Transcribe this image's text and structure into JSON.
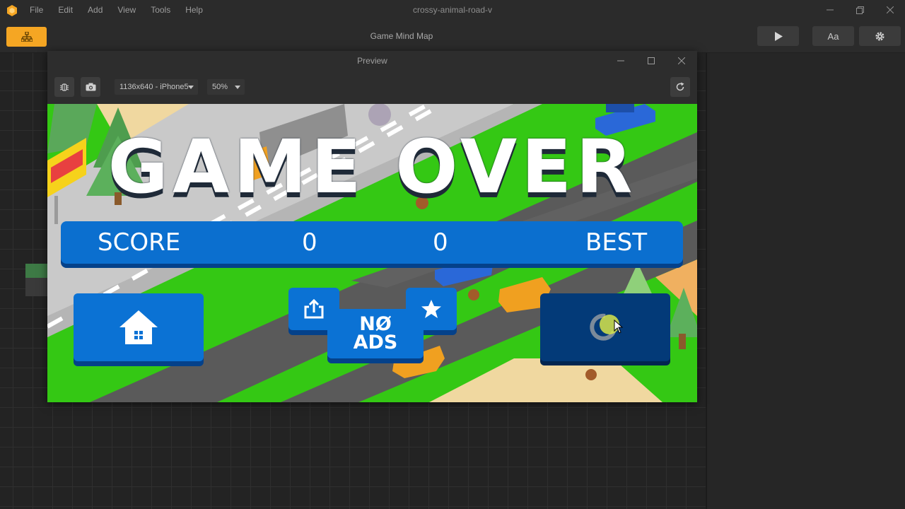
{
  "app": {
    "title": "crossy-animal-road-v",
    "menu": [
      "File",
      "Edit",
      "Add",
      "View",
      "Tools",
      "Help"
    ],
    "toolbar_title": "Game Mind Map",
    "font_button_label": "Aa"
  },
  "preview": {
    "title": "Preview",
    "resolution": "1136x640 - iPhone5",
    "zoom": "50%"
  },
  "game": {
    "title": "GAME OVER",
    "score_label": "SCORE",
    "score_value": "0",
    "best_value": "0",
    "best_label": "BEST",
    "no_ads_line1": "NØ",
    "no_ads_line2": "ADS"
  },
  "colors": {
    "accent": "#f5a623",
    "grass": "#34c814",
    "road": "#5a5a5a",
    "button_blue": "#0b72d4",
    "button_dark": "#033a78"
  },
  "icons": [
    "app-logo-icon",
    "mindmap-icon",
    "play-icon",
    "gear-icon",
    "debug-icon",
    "camera-icon",
    "refresh-icon",
    "home-icon",
    "share-icon",
    "star-icon",
    "restart-icon",
    "cursor-icon"
  ]
}
